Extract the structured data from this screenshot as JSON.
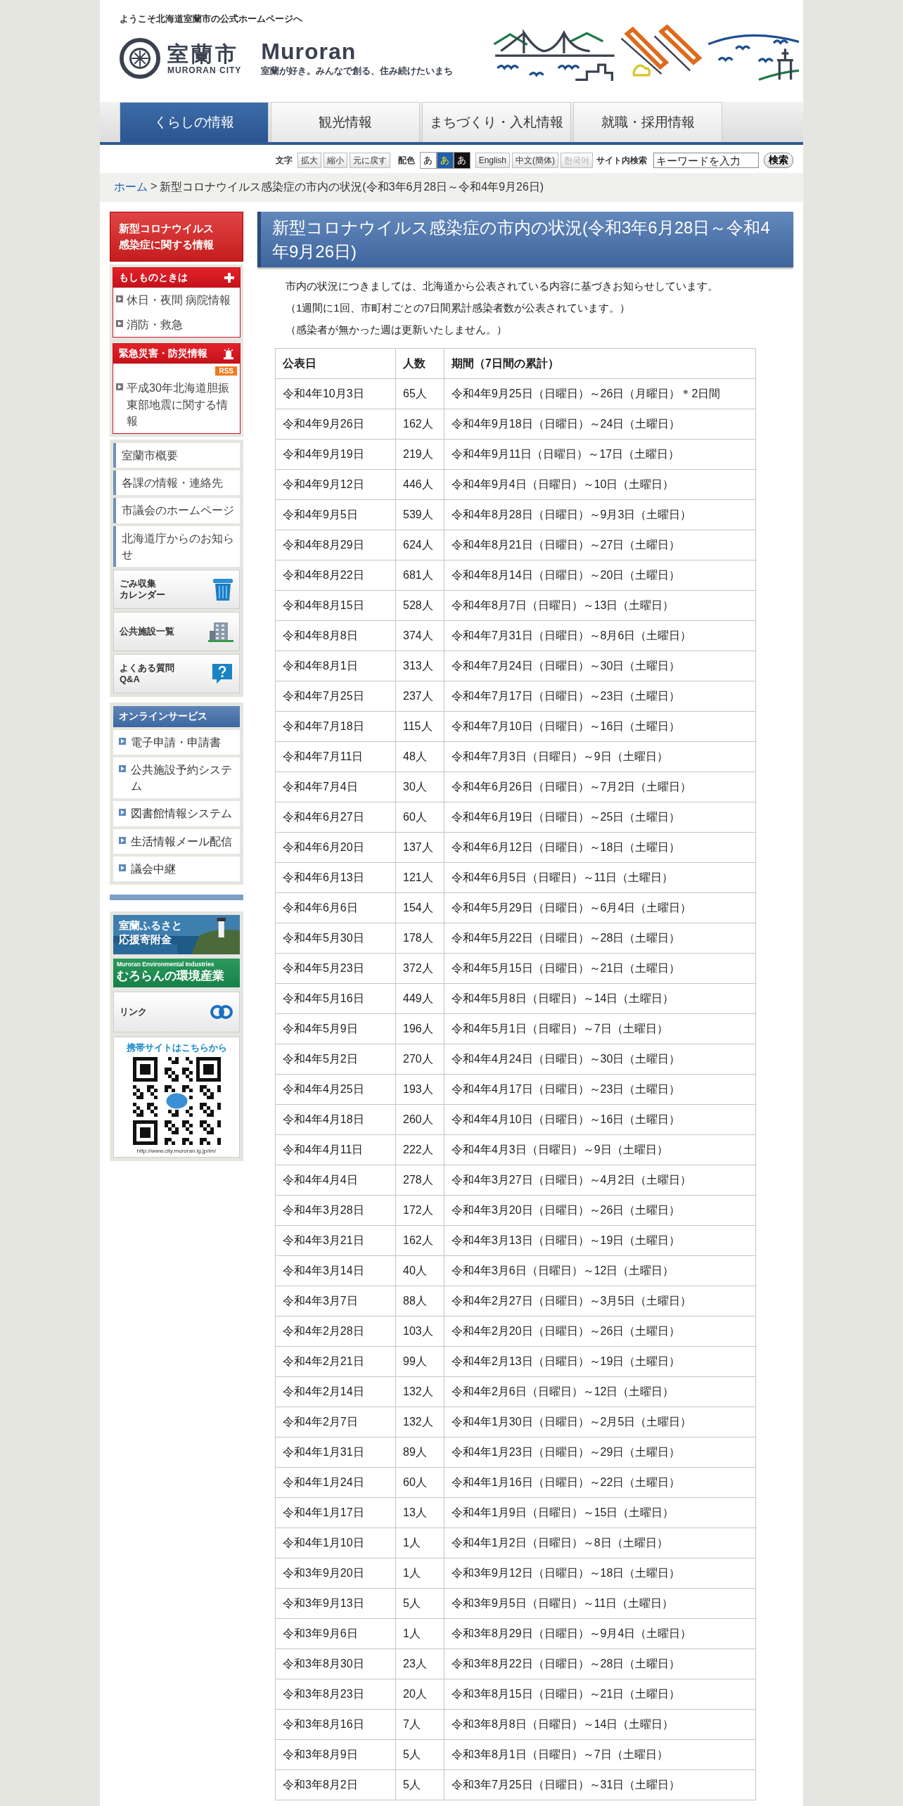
{
  "header": {
    "welcome": "ようこそ北海道室蘭市の公式ホームページへ",
    "city_name": "室蘭市",
    "city_name_en": "MURORAN CITY",
    "brand": "Muroran",
    "slogan": "室蘭が好き。みんなで創る、住み続けたいまち"
  },
  "nav_tabs": [
    {
      "label": "くらしの情報",
      "selected": true
    },
    {
      "label": "観光情報",
      "selected": false
    },
    {
      "label": "まちづくり・入札情報",
      "selected": false
    },
    {
      "label": "就職・採用情報",
      "selected": false
    }
  ],
  "toolbar": {
    "text_size_label": "文字",
    "text_size_buttons": [
      "拡大",
      "縮小",
      "元に戻す"
    ],
    "color_label": "配色",
    "color_schemes": [
      {
        "label": "あ",
        "kind": "light"
      },
      {
        "label": "あ",
        "kind": "blue"
      },
      {
        "label": "あ",
        "kind": "dark"
      }
    ],
    "languages": [
      {
        "label": "English",
        "disabled": false
      },
      {
        "label": "中文(簡体)",
        "disabled": false
      },
      {
        "label": "한국어",
        "disabled": true
      }
    ],
    "search_label": "サイト内検索",
    "search": {
      "placeholder": "キーワードを入力"
    },
    "search_button": "検索"
  },
  "breadcrumb": {
    "home": "ホーム",
    "separator": ">",
    "current": "新型コロナウイルス感染症の市内の状況(令和3年6月28日～令和4年9月26日)"
  },
  "sidebar": {
    "covid_banner": [
      "新型コロナウイルス",
      "感染症に関する情報"
    ],
    "emergency": {
      "title": "もしものときは",
      "links": [
        "休日・夜間 病院情報",
        "消防・救急"
      ]
    },
    "disaster": {
      "title": "緊急災害・防災情報",
      "rss": "RSS",
      "links": [
        "平成30年北海道胆振東部地震に関する情報"
      ]
    },
    "city_links": [
      "室蘭市概要",
      "各課の情報・連絡先",
      "市議会のホームページ",
      "北海道庁からのお知らせ"
    ],
    "feature_banners": [
      {
        "lines": [
          "ごみ収集",
          "カレンダー"
        ],
        "kind": "trash"
      },
      {
        "lines": [
          "公共施設一覧"
        ],
        "kind": "building"
      },
      {
        "lines": [
          "よくある質問",
          "Q&A"
        ],
        "kind": "faq"
      }
    ],
    "online": {
      "title": "オンラインサービス",
      "links": [
        "電子申請・申請書",
        "公共施設予約システム",
        "図書館情報システム",
        "生活情報メール配信",
        "議会中継"
      ]
    },
    "furusato_banner": [
      "室蘭ふるさと",
      "応援寄附金"
    ],
    "env_banner": {
      "caption": "Muroran Environmental Industries",
      "title": "むろらんの環境産業"
    },
    "link_banner": "リンク",
    "mobile": {
      "title": "携帯サイトはこちらから",
      "url": "http://www.city.muroran.lg.jp/im/"
    }
  },
  "main": {
    "title": "新型コロナウイルス感染症の市内の状況(令和3年6月28日～令和4年9月26日)",
    "paragraphs": [
      "市内の状況につきましては、北海道から公表されている内容に基づきお知らせしています。",
      "（1週間に1回、市町村ごとの7日間累計感染者数が公表されています。）",
      "（感染者が無かった週は更新いたしません。）"
    ],
    "table": {
      "columns": [
        "公表日",
        "人数",
        "期間（7日間の累計）"
      ],
      "rows": [
        [
          "令和4年10月3日",
          "65人",
          "令和4年9月25日（日曜日）～26日（月曜日）＊2日間"
        ],
        [
          "令和4年9月26日",
          "162人",
          "令和4年9月18日（日曜日）～24日（土曜日）"
        ],
        [
          "令和4年9月19日",
          "219人",
          "令和4年9月11日（日曜日）～17日（土曜日）"
        ],
        [
          "令和4年9月12日",
          "446人",
          "令和4年9月4日（日曜日）～10日（土曜日）"
        ],
        [
          "令和4年9月5日",
          "539人",
          "令和4年8月28日（日曜日）～9月3日（土曜日）"
        ],
        [
          "令和4年8月29日",
          "624人",
          "令和4年8月21日（日曜日）～27日（土曜日）"
        ],
        [
          "令和4年8月22日",
          "681人",
          "令和4年8月14日（日曜日）～20日（土曜日）"
        ],
        [
          "令和4年8月15日",
          "528人",
          "令和4年8月7日（日曜日）～13日（土曜日）"
        ],
        [
          "令和4年8月8日",
          "374人",
          "令和4年7月31日（日曜日）～8月6日（土曜日）"
        ],
        [
          "令和4年8月1日",
          "313人",
          "令和4年7月24日（日曜日）～30日（土曜日）"
        ],
        [
          "令和4年7月25日",
          "237人",
          "令和4年7月17日（日曜日）～23日（土曜日）"
        ],
        [
          "令和4年7月18日",
          "115人",
          "令和4年7月10日（日曜日）～16日（土曜日）"
        ],
        [
          "令和4年7月11日",
          "48人",
          "令和4年7月3日（日曜日）～9日（土曜日）"
        ],
        [
          "令和4年7月4日",
          "30人",
          "令和4年6月26日（日曜日）～7月2日（土曜日）"
        ],
        [
          "令和4年6月27日",
          "60人",
          "令和4年6月19日（日曜日）～25日（土曜日）"
        ],
        [
          "令和4年6月20日",
          "137人",
          "令和4年6月12日（日曜日）～18日（土曜日）"
        ],
        [
          "令和4年6月13日",
          "121人",
          "令和4年6月5日（日曜日）～11日（土曜日）"
        ],
        [
          "令和4年6月6日",
          "154人",
          "令和4年5月29日（日曜日）～6月4日（土曜日）"
        ],
        [
          "令和4年5月30日",
          "178人",
          "令和4年5月22日（日曜日）～28日（土曜日）"
        ],
        [
          "令和4年5月23日",
          "372人",
          "令和4年5月15日（日曜日）～21日（土曜日）"
        ],
        [
          "令和4年5月16日",
          "449人",
          "令和4年5月8日（日曜日）～14日（土曜日）"
        ],
        [
          "令和4年5月9日",
          "196人",
          "令和4年5月1日（日曜日）～7日（土曜日）"
        ],
        [
          "令和4年5月2日",
          "270人",
          "令和4年4月24日（日曜日）～30日（土曜日）"
        ],
        [
          "令和4年4月25日",
          "193人",
          "令和4年4月17日（日曜日）～23日（土曜日）"
        ],
        [
          "令和4年4月18日",
          "260人",
          "令和4年4月10日（日曜日）～16日（土曜日）"
        ],
        [
          "令和4年4月11日",
          "222人",
          "令和4年4月3日（日曜日）～9日（土曜日）"
        ],
        [
          "令和4年4月4日",
          "278人",
          "令和4年3月27日（日曜日）～4月2日（土曜日）"
        ],
        [
          "令和4年3月28日",
          "172人",
          "令和4年3月20日（日曜日）～26日（土曜日）"
        ],
        [
          "令和4年3月21日",
          "162人",
          "令和4年3月13日（日曜日）～19日（土曜日）"
        ],
        [
          "令和4年3月14日",
          "40人",
          "令和4年3月6日（日曜日）～12日（土曜日）"
        ],
        [
          "令和4年3月7日",
          "88人",
          "令和4年2月27日（日曜日）～3月5日（土曜日）"
        ],
        [
          "令和4年2月28日",
          "103人",
          "令和4年2月20日（日曜日）～26日（土曜日）"
        ],
        [
          "令和4年2月21日",
          "99人",
          "令和4年2月13日（日曜日）～19日（土曜日）"
        ],
        [
          "令和4年2月14日",
          "132人",
          "令和4年2月6日（日曜日）～12日（土曜日）"
        ],
        [
          "令和4年2月7日",
          "132人",
          "令和4年1月30日（日曜日）～2月5日（土曜日）"
        ],
        [
          "令和4年1月31日",
          "89人",
          "令和4年1月23日（日曜日）～29日（土曜日）"
        ],
        [
          "令和4年1月24日",
          "60人",
          "令和4年1月16日（日曜日）～22日（土曜日）"
        ],
        [
          "令和4年1月17日",
          "13人",
          "令和4年1月9日（日曜日）～15日（土曜日）"
        ],
        [
          "令和4年1月10日",
          "1人",
          "令和4年1月2日（日曜日）～8日（土曜日）"
        ],
        [
          "令和3年9月20日",
          "1人",
          "令和3年9月12日（日曜日）～18日（土曜日）"
        ],
        [
          "令和3年9月13日",
          "5人",
          "令和3年9月5日（日曜日）～11日（土曜日）"
        ],
        [
          "令和3年9月6日",
          "1人",
          "令和3年8月29日（日曜日）～9月4日（土曜日）"
        ],
        [
          "令和3年8月30日",
          "23人",
          "令和3年8月22日（日曜日）～28日（土曜日）"
        ],
        [
          "令和3年8月23日",
          "20人",
          "令和3年8月15日（日曜日）～21日（土曜日）"
        ],
        [
          "令和3年8月16日",
          "7人",
          "令和3年8月8日（日曜日）～14日（土曜日）"
        ],
        [
          "令和3年8月9日",
          "5人",
          "令和3年8月1日（日曜日）～7日（土曜日）"
        ],
        [
          "令和3年8月2日",
          "5人",
          "令和3年7月25日（日曜日）～31日（土曜日）"
        ]
      ]
    }
  }
}
